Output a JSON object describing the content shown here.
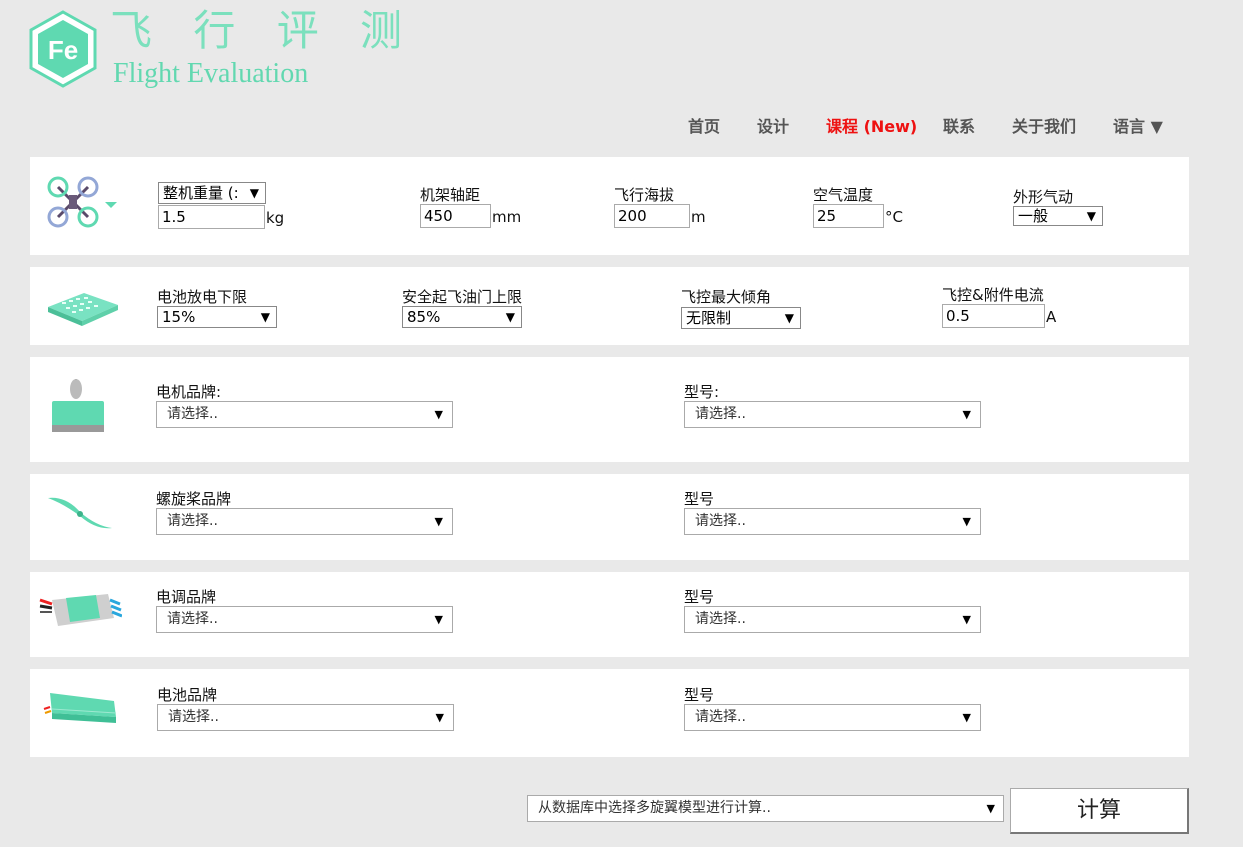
{
  "brand": {
    "logo_text": "Fe",
    "title_cn": "飞 行 评 测",
    "title_en": "Flight Evaluation",
    "accent_color": "#62d8b0"
  },
  "nav": {
    "items": [
      {
        "label": "首页"
      },
      {
        "label": "设计"
      },
      {
        "label": "课程 (New)"
      },
      {
        "label": "联系"
      },
      {
        "label": "关于我们"
      },
      {
        "label": "语言 ▼"
      }
    ],
    "active_color": "#ee1111"
  },
  "aircraft": {
    "icon": "quadcopter-icon",
    "weight_select": "整机重量 (:",
    "weight_value": "1.5",
    "weight_unit": "kg",
    "wheelbase_label": "机架轴距",
    "wheelbase_value": "450",
    "wheelbase_unit": "mm",
    "altitude_label": "飞行海拔",
    "altitude_value": "200",
    "altitude_unit": "m",
    "temp_label": "空气温度",
    "temp_value": "25",
    "temp_unit": "°C",
    "aero_label": "外形气动",
    "aero_value": "一般"
  },
  "battery_settings": {
    "icon": "battery-board-icon",
    "discharge_label": "电池放电下限",
    "discharge_value": "15%",
    "throttle_label": "安全起飞油门上限",
    "throttle_value": "85%",
    "tilt_label": "飞控最大倾角",
    "tilt_value": "无限制",
    "current_label": "飞控&附件电流",
    "current_value": "0.5",
    "current_unit": "A"
  },
  "components": [
    {
      "icon": "motor-icon",
      "brand_label": "电机品牌:",
      "brand_value": "请选择..",
      "model_label": "型号:",
      "model_value": "请选择.."
    },
    {
      "icon": "propeller-icon",
      "brand_label": "螺旋桨品牌",
      "brand_value": "请选择..",
      "model_label": "型号",
      "model_value": "请选择.."
    },
    {
      "icon": "esc-icon",
      "brand_label": "电调品牌",
      "brand_value": "请选择..",
      "model_label": "型号",
      "model_value": "请选择.."
    },
    {
      "icon": "battery-icon",
      "brand_label": "电池品牌",
      "brand_value": "请选择..",
      "model_label": "型号",
      "model_value": "请选择.."
    }
  ],
  "footer": {
    "db_select": "从数据库中选择多旋翼模型进行计算..",
    "calc_button": "计算"
  }
}
